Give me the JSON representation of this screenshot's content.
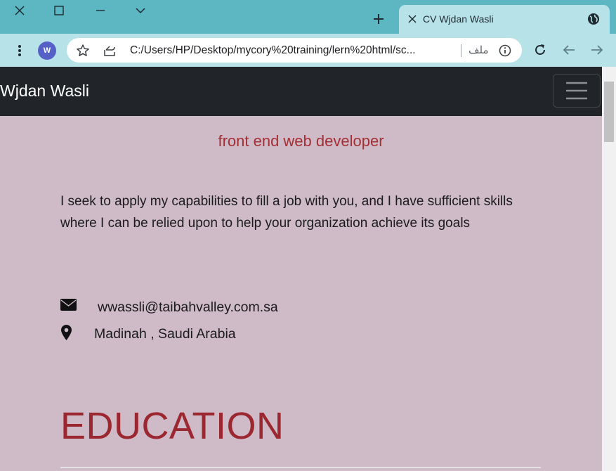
{
  "browser": {
    "tab_title": "CV Wjdan Wasli",
    "avatar_letter": "W",
    "url": "C:/Users/HP/Desktop/mycory%20training/lern%20html/sc...",
    "file_label": "ملف"
  },
  "navbar": {
    "brand": "Wjdan Wasli"
  },
  "page": {
    "subtitle": "front end web developer",
    "summary": "I seek to apply my capabilities to fill a job with you, and I have sufficient skills where I can be relied upon to help your organization achieve its goals",
    "contact": {
      "email": "wwassli@taibahvalley.com.sa",
      "location": "Madinah , Saudi Arabia"
    },
    "education_heading": "EDUCATION"
  },
  "icons": [
    "close-icon",
    "maximize-icon",
    "minimize-icon",
    "chevron-down-icon",
    "plus-icon",
    "globe-icon",
    "menu-dots-icon",
    "star-icon",
    "share-icon",
    "info-icon",
    "reload-icon",
    "back-arrow-icon",
    "forward-arrow-icon",
    "hamburger-icon",
    "envelope-icon",
    "map-pin-icon"
  ],
  "colors": {
    "titlebar": "#5cb7c2",
    "toolbar": "#b6e2e8",
    "navbar": "#212529",
    "page_bg": "#cfbac7",
    "accent_red": "#a33035"
  }
}
